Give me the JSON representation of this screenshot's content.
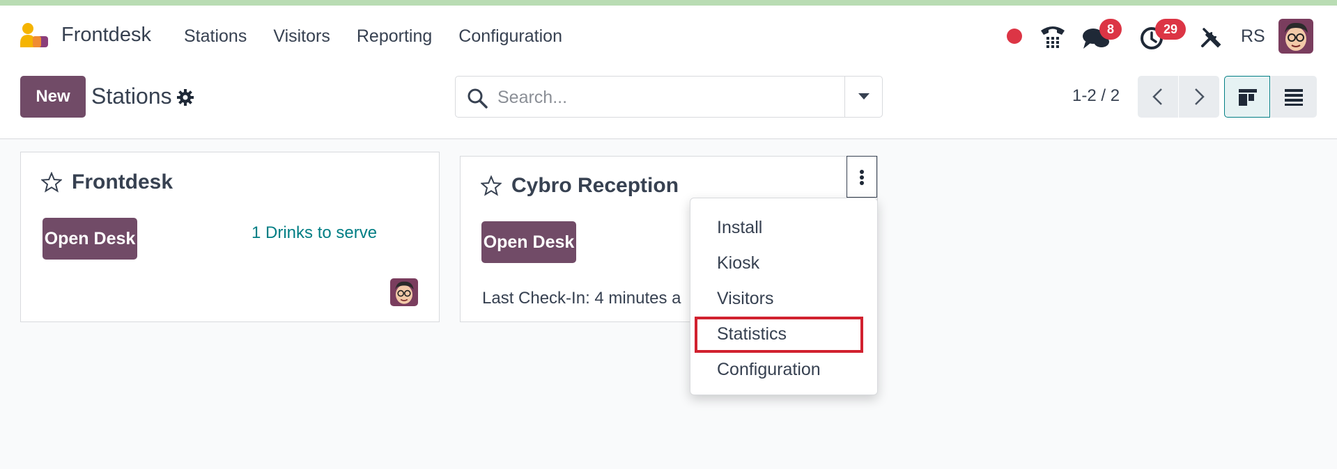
{
  "app": {
    "name": "Frontdesk"
  },
  "menu": [
    "Stations",
    "Visitors",
    "Reporting",
    "Configuration"
  ],
  "systray": {
    "messages_count": "8",
    "activities_count": "29",
    "user_initials": "RS"
  },
  "control": {
    "new_label": "New",
    "breadcrumb": "Stations",
    "search_placeholder": "Search...",
    "pager": "1-2 / 2"
  },
  "cards": [
    {
      "title": "Frontdesk",
      "open_label": "Open Desk",
      "drinks": "1 Drinks to serve"
    },
    {
      "title": "Cybro Reception",
      "open_label": "Open Desk",
      "last_checkin": "Last Check-In: 4 minutes a"
    }
  ],
  "dropdown": {
    "items": [
      "Install",
      "Kiosk",
      "Visitors",
      "Statistics",
      "Configuration"
    ],
    "highlighted": "Statistics"
  },
  "colors": {
    "primary": "#714b67",
    "link": "#017e84",
    "badge": "#dc3545",
    "highlight_box": "#d1212f"
  }
}
